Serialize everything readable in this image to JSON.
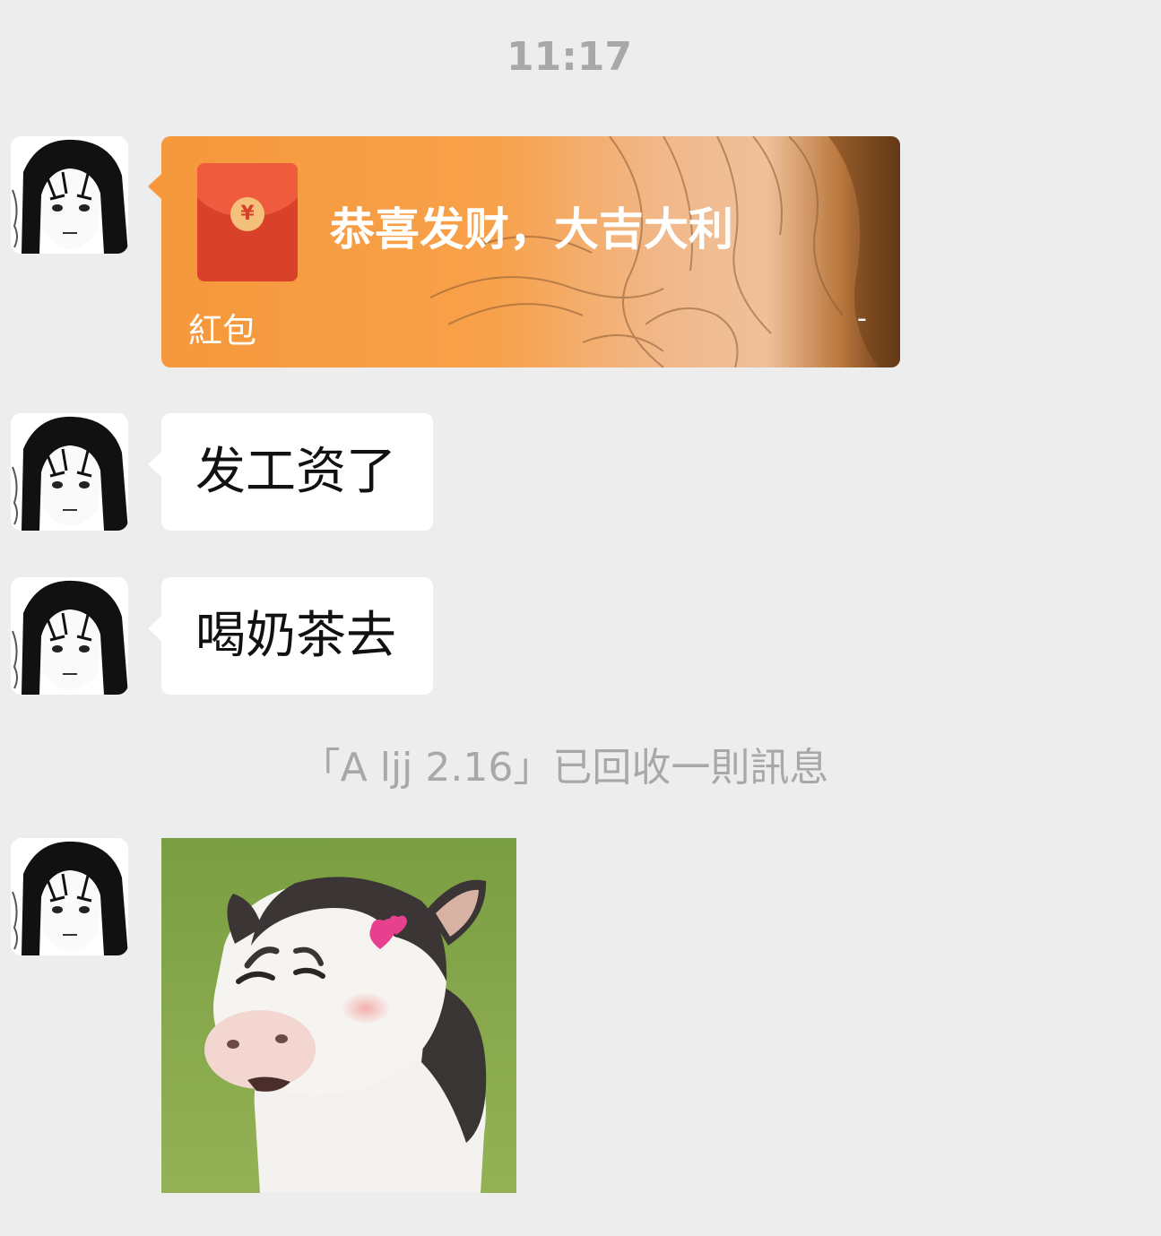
{
  "chat": {
    "timestamp": "11:17",
    "messages": [
      {
        "kind": "red_packet",
        "avatar_icon": "manga-girl-avatar-icon",
        "greeting": "恭喜发财，大吉大利",
        "label": "紅包",
        "footer_mark": "-",
        "envelope_symbol": "¥"
      },
      {
        "kind": "text",
        "avatar_icon": "manga-girl-avatar-icon",
        "text": "发工资了"
      },
      {
        "kind": "text",
        "avatar_icon": "manga-girl-avatar-icon",
        "text": "喝奶茶去"
      },
      {
        "kind": "sticker",
        "avatar_icon": "manga-girl-avatar-icon",
        "sticker_icon": "winking-cow-sticker-icon"
      }
    ],
    "recall_notice": "「A ljj 2.16」已回收一則訊息"
  },
  "colors": {
    "background": "#ededed",
    "bubble": "#ffffff",
    "red_packet": "#f6983c",
    "envelope": "#d9412b",
    "system_text": "#a8a8a8"
  }
}
